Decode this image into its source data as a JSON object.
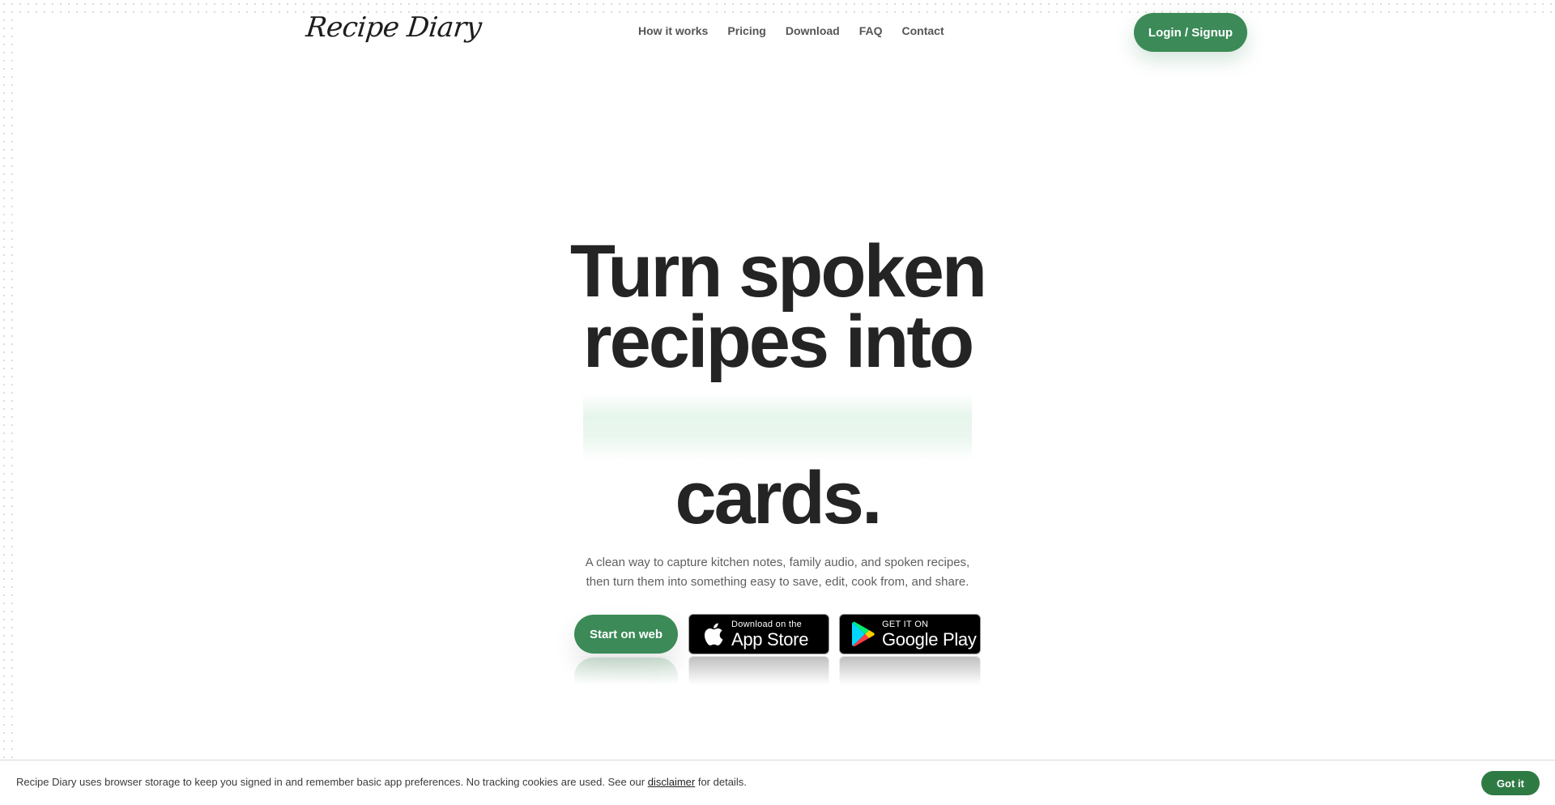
{
  "header": {
    "brand": "Recipe Diary",
    "nav": [
      "How it works",
      "Pricing",
      "Download",
      "FAQ",
      "Contact"
    ],
    "login_label": "Login / Signup"
  },
  "hero": {
    "title_line1": "Turn spoken",
    "title_line2": "recipes into",
    "title_line3": "cards.",
    "subtitle_line1": "A clean way to capture kitchen notes, family audio, and spoken recipes,",
    "subtitle_line2": "then turn them into something easy to save, edit, cook from, and share."
  },
  "cta": {
    "web_label": "Start on web",
    "app_store": {
      "small": "Download on the",
      "big": "App Store",
      "icon": "apple-icon"
    },
    "google_play": {
      "small": "GET IT ON",
      "big": "Google Play",
      "icon": "google-play-icon"
    }
  },
  "cookie": {
    "text_before": "Recipe Diary uses browser storage to keep you signed in and remember basic app preferences. No tracking cookies are used. See our",
    "link_label": "disclaimer",
    "text_after": "for details.",
    "button_label": "Got it"
  },
  "colors": {
    "accent": "#3b8a57",
    "cookie_button": "#2e7a43",
    "title": "#242424"
  }
}
